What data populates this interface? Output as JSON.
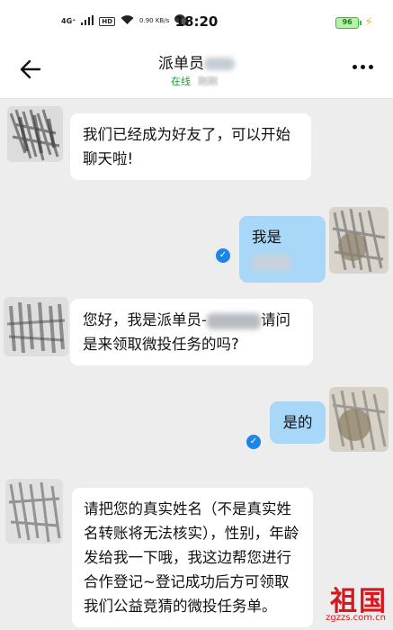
{
  "status_bar": {
    "network": "4G⁺",
    "hd_label": "HD",
    "speed": "0.90 KB/s",
    "time": "18:20",
    "battery": "96"
  },
  "header": {
    "title": "派单员",
    "online": "在线",
    "online_extra": "刚刚"
  },
  "messages": [
    {
      "side": "in",
      "text": "我们已经成为好友了，可以开始聊天啦!"
    },
    {
      "side": "out",
      "text_prefix": "我是"
    },
    {
      "side": "in",
      "text_a": "您好，我是派单员-",
      "text_b": "请问是来领取微投任务的吗?"
    },
    {
      "side": "out",
      "text": "是的"
    },
    {
      "side": "in",
      "text": "请把您的真实姓名（不是真实姓名转账将无法核实），性别，年龄发给我一下哦，我这边帮您进行合作登记~登记成功后方可领取我们公益竞猜的微投任务单。"
    }
  ],
  "watermark": {
    "brand": "祖国",
    "url": "zgzzs.com.cn"
  },
  "colors": {
    "outgoing_bubble": "#a9d7f8",
    "incoming_bubble": "#ffffff",
    "online_green": "#1f9b3a",
    "read_blue": "#1a86e8",
    "watermark_red": "#d7171e"
  }
}
